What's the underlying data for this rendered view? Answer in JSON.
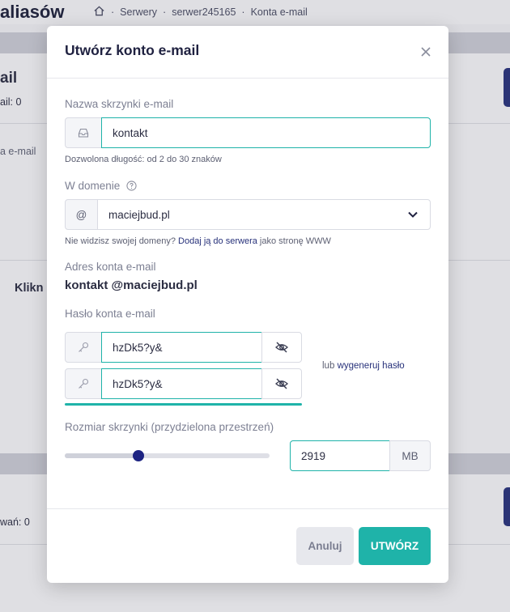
{
  "background": {
    "title_fragment": "aliasów",
    "breadcrumbs": [
      "Serwery",
      "serwer245165",
      "Konta e-mail"
    ],
    "separator": "·",
    "heading_fragment": "ail",
    "count1": "ail: 0",
    "row_fragment": "a e-mail",
    "click_fragment": "Klikn",
    "count2": "wań: 0"
  },
  "modal": {
    "title": "Utwórz konto e-mail",
    "mailbox": {
      "label": "Nazwa skrzynki e-mail",
      "value": "kontakt",
      "hint": "Dozwolona długość: od 2 do 30 znaków"
    },
    "domain": {
      "label": "W domenie",
      "prefix": "@",
      "value": "maciejbud.pl",
      "hint_before": "Nie widzisz swojej domeny?",
      "hint_link": "Dodaj ją do serwera",
      "hint_after": "jako stronę WWW"
    },
    "address": {
      "label": "Adres konta e-mail",
      "value": "kontakt @maciejbud.pl"
    },
    "password": {
      "label": "Hasło konta e-mail",
      "value": "hzDk5?y&",
      "confirm_value": "hzDk5?y&",
      "generate_prefix": "lub",
      "generate_link": "wygeneruj hasło",
      "strength": 1.0
    },
    "size": {
      "label": "Rozmiar skrzynki (przydzielona przestrzeń)",
      "value": "2919",
      "unit": "MB",
      "slider_fraction": 0.36
    },
    "buttons": {
      "cancel": "Anuluj",
      "create": "UTWÓRZ"
    }
  },
  "colors": {
    "accent": "#1fb3a9",
    "brand": "#27317a",
    "knob": "#1d2482"
  },
  "icons": {
    "close": "close-icon",
    "mailbox": "inbox-icon",
    "help": "help-circle-icon",
    "dropdown": "chevron-down-icon",
    "password": "key-icon",
    "toggle": "eye-off-icon",
    "home": "home-icon"
  }
}
